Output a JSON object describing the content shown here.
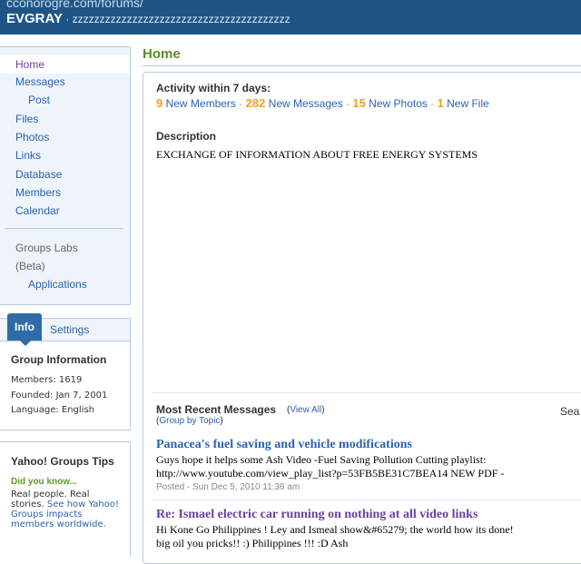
{
  "header": {
    "url_fragment": "cconorogre.com/forums/",
    "group_name": "EVGRAY",
    "sep": " · ",
    "group_desc": "zzzzzzzzzzzzzzzzzzzzzzzzzzzzzzzzzzzzzzzz"
  },
  "nav": {
    "items": [
      {
        "label": "Home"
      },
      {
        "label": "Messages"
      },
      {
        "label": "Post"
      },
      {
        "label": "Files"
      },
      {
        "label": "Photos"
      },
      {
        "label": "Links"
      },
      {
        "label": "Database"
      },
      {
        "label": "Members"
      },
      {
        "label": "Calendar"
      }
    ],
    "labs_line1": "Groups Labs",
    "labs_line2": "(Beta)",
    "applications": "Applications"
  },
  "info_panel": {
    "tab_info": "Info",
    "tab_settings": "Settings",
    "title": "Group Information",
    "members": "Members: 1619",
    "founded": "Founded: Jan 7, 2001",
    "language": "Language: English"
  },
  "tips": {
    "title": "Yahoo! Groups Tips",
    "did_you_know": "Did you know...",
    "text": "Real people. Real stories.",
    "link": "See how Yahoo! Groups impacts members worldwide."
  },
  "main": {
    "title": "Home",
    "activity_label": "Activity within 7 days:",
    "activity": [
      {
        "num": "9",
        "label": "New Members"
      },
      {
        "num": "282",
        "label": "New Messages"
      },
      {
        "num": "15",
        "label": "New Photos"
      },
      {
        "num": "1",
        "label": "New File"
      }
    ],
    "activity_sep": " - ",
    "description_label": "Description",
    "description_text": "EXCHANGE OF INFORMATION ABOUT FREE ENERGY SYSTEMS",
    "recent_label": "Most Recent Messages",
    "paren_open": "(",
    "paren_close": ")",
    "view_all": "View All",
    "group_by_topic": "Group by Topic",
    "search_cut": "Sea"
  },
  "messages": [
    {
      "title": "Panacea's fuel saving and vehicle modifications",
      "line1": "Guys hope it helps some Ash Video -Fuel Saving Pollution Cutting playlist:",
      "line2": "http://www.youtube.com/view_play_list?p=53FB5BE31C7BEA14 NEW PDF -",
      "meta": "Posted - Sun Dec 5, 2010 11:36 am"
    },
    {
      "title": "Re: Ismael electric car running on nothing at all video links",
      "line1": "Hi Kone Go Philippines ! Ley and Ismeal show&#65279; the world how its done!",
      "line2": "big oil you pricks!! :) Philippines !!! :D Ash"
    }
  ],
  "colors": {
    "header_bg": "#1f5585",
    "link": "#2b62b0",
    "visited": "#6b3fa0",
    "accent_orange": "#f0a01e",
    "home_green": "#5c8a2e"
  }
}
